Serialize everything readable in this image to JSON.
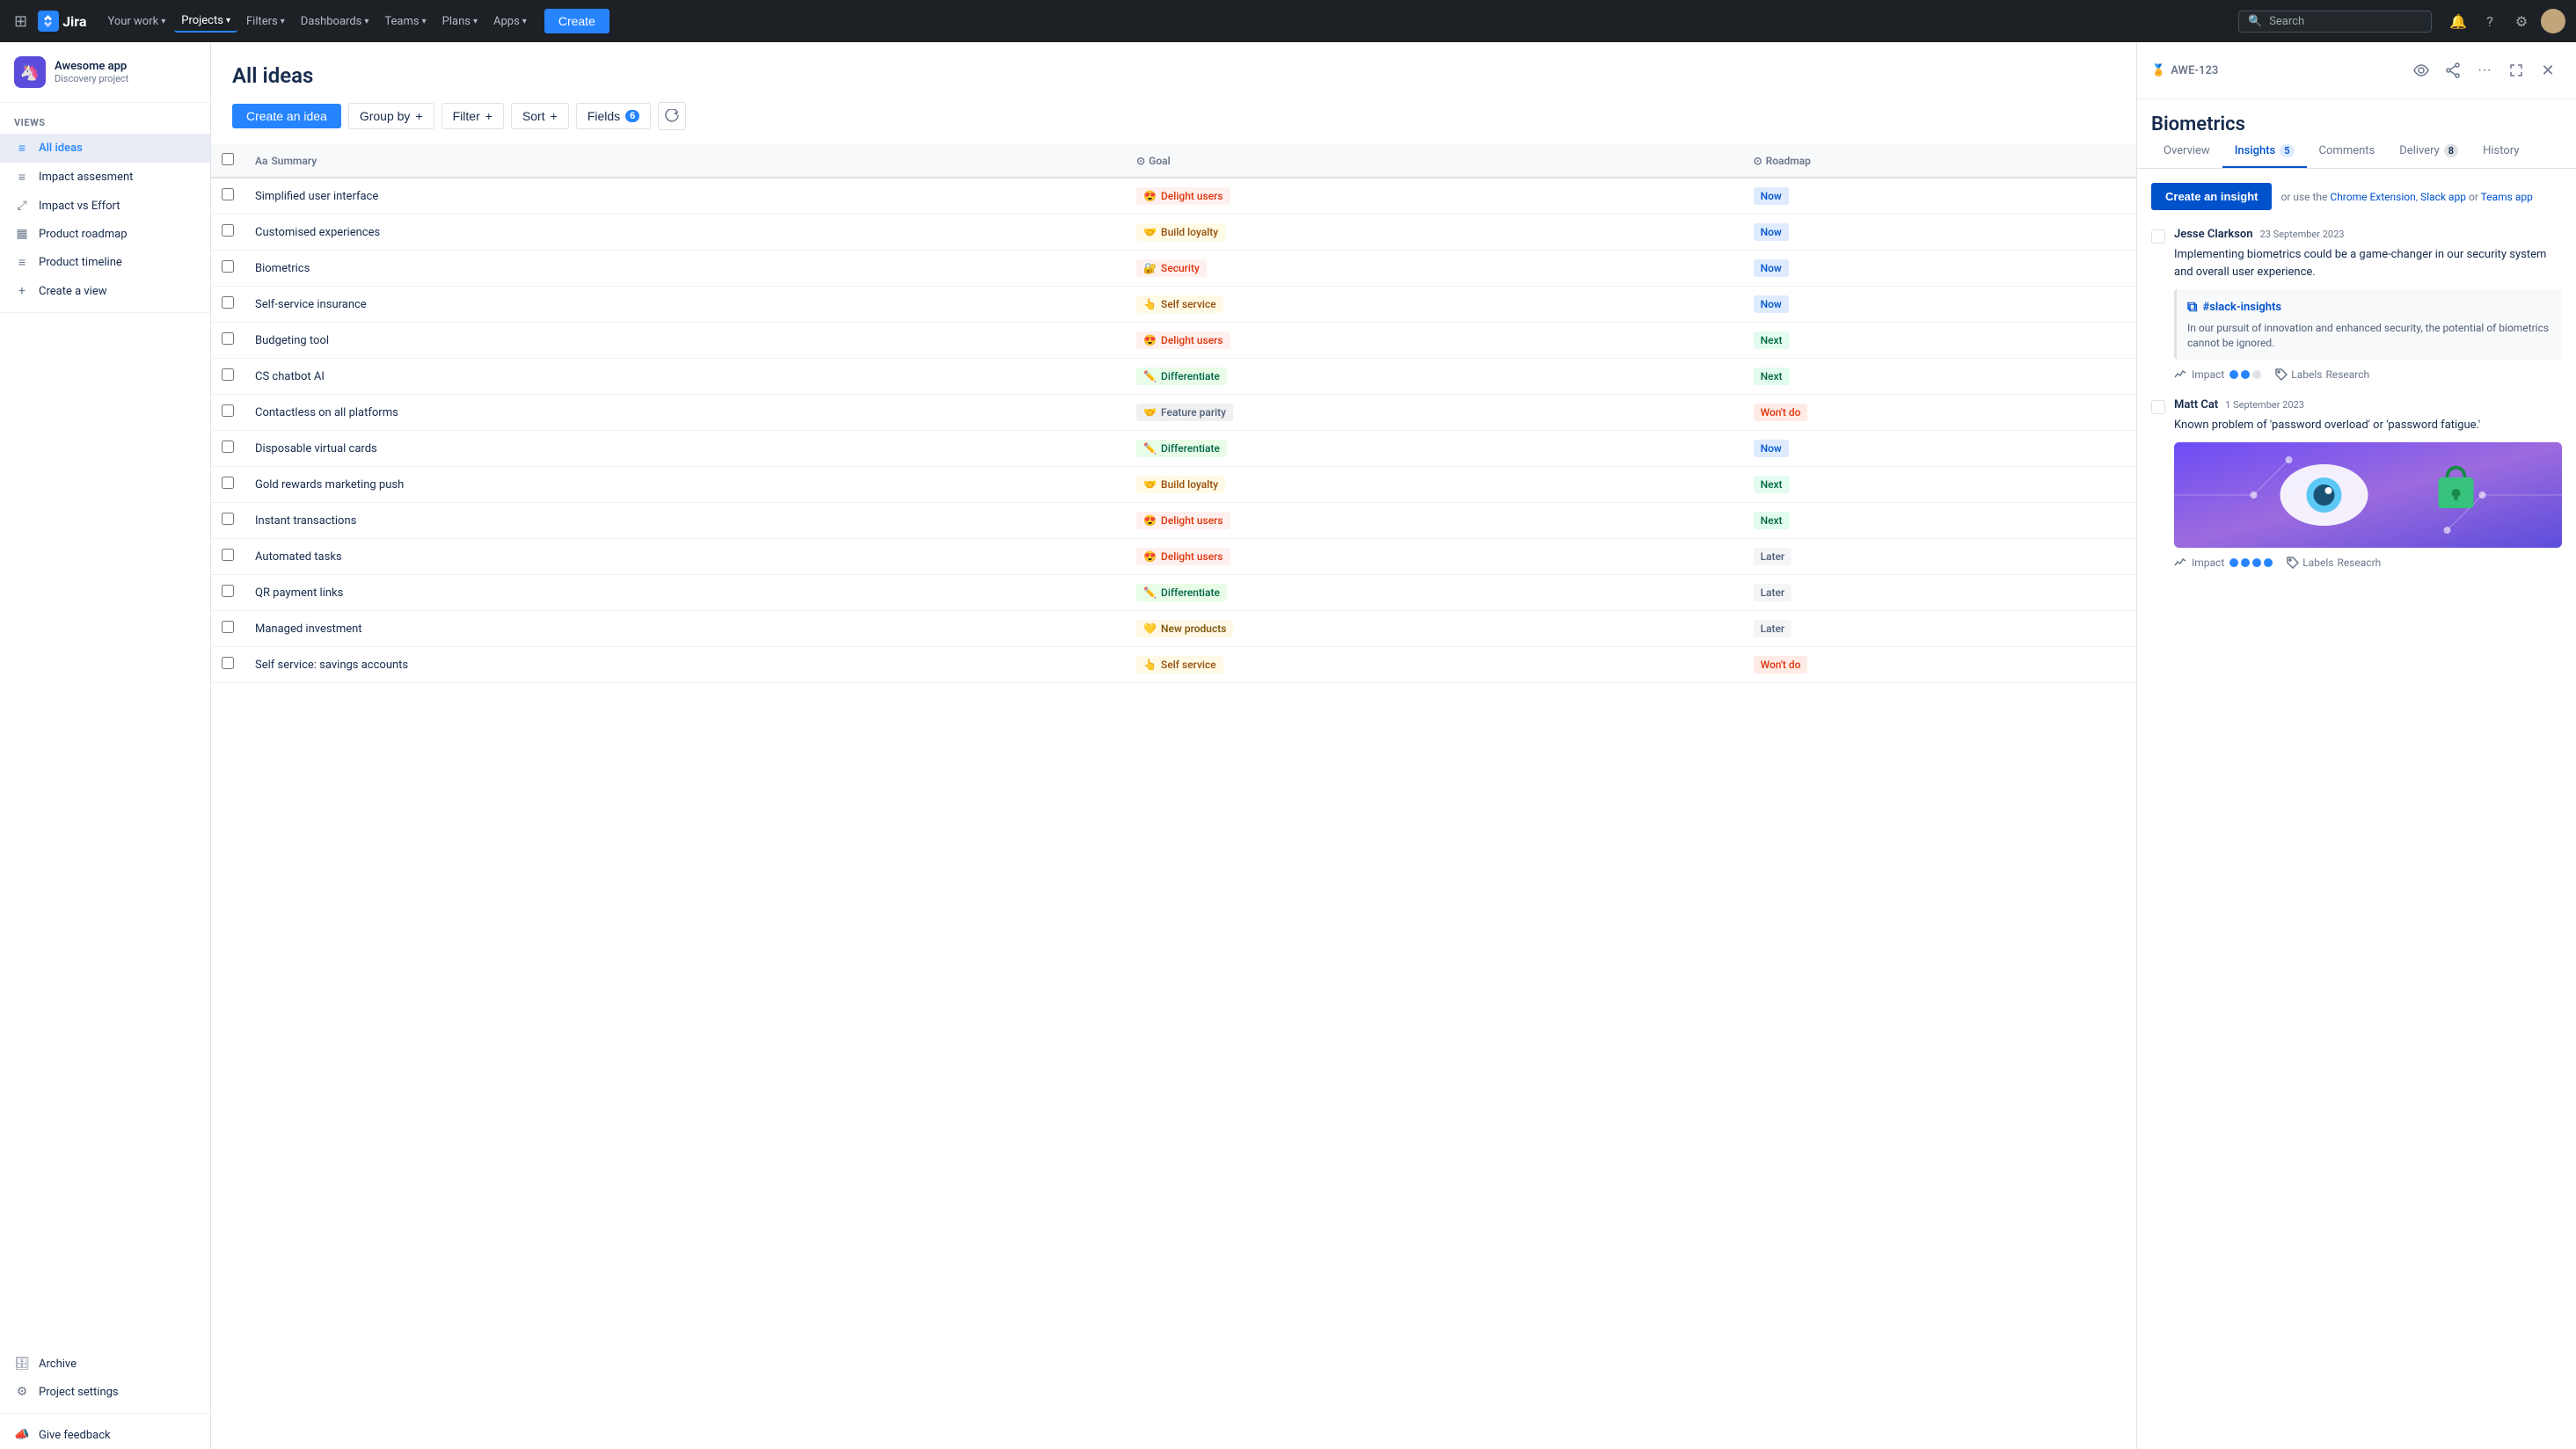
{
  "topnav": {
    "logo_text": "Jira",
    "nav_items": [
      {
        "label": "Your work",
        "has_dropdown": true,
        "active": false
      },
      {
        "label": "Projects",
        "has_dropdown": true,
        "active": true
      },
      {
        "label": "Filters",
        "has_dropdown": true,
        "active": false
      },
      {
        "label": "Dashboards",
        "has_dropdown": true,
        "active": false
      },
      {
        "label": "Teams",
        "has_dropdown": true,
        "active": false
      },
      {
        "label": "Plans",
        "has_dropdown": true,
        "active": false
      },
      {
        "label": "Apps",
        "has_dropdown": true,
        "active": false
      }
    ],
    "create_label": "Create",
    "search_placeholder": "Search"
  },
  "sidebar": {
    "project_name": "Awesome app",
    "project_type": "Discovery project",
    "views_label": "VIEWS",
    "views": [
      {
        "label": "All ideas",
        "icon": "≡",
        "active": true
      },
      {
        "label": "Impact assesment",
        "icon": "≡",
        "active": false
      },
      {
        "label": "Impact vs Effort",
        "icon": "⤢",
        "active": false
      },
      {
        "label": "Product roadmap",
        "icon": "▦",
        "active": false
      },
      {
        "label": "Product timeline",
        "icon": "≡",
        "active": false
      }
    ],
    "create_view_label": "Create a view",
    "archive_label": "Archive",
    "project_settings_label": "Project settings",
    "feedback_label": "Give feedback"
  },
  "main": {
    "title": "All ideas",
    "toolbar": {
      "create_label": "Create an idea",
      "group_by_label": "Group by",
      "filter_label": "Filter",
      "sort_label": "Sort",
      "fields_label": "Fields",
      "fields_count": "6"
    },
    "table_headers": [
      "",
      "Summary",
      "Goal",
      "Roadmap"
    ],
    "ideas": [
      {
        "summary": "Simplified user interface",
        "goal": "Delight users",
        "goal_class": "goal-delight",
        "goal_emoji": "😍",
        "roadmap": "Now",
        "roadmap_class": "roadmap-now"
      },
      {
        "summary": "Customised experiences",
        "goal": "Build loyalty",
        "goal_class": "goal-loyalty",
        "goal_emoji": "🤝",
        "roadmap": "Now",
        "roadmap_class": "roadmap-now"
      },
      {
        "summary": "Biometrics",
        "goal": "Security",
        "goal_class": "goal-security",
        "goal_emoji": "🔐",
        "roadmap": "Now",
        "roadmap_class": "roadmap-now"
      },
      {
        "summary": "Self-service insurance",
        "goal": "Self service",
        "goal_class": "goal-selfservice",
        "goal_emoji": "👆",
        "roadmap": "Now",
        "roadmap_class": "roadmap-now"
      },
      {
        "summary": "Budgeting tool",
        "goal": "Delight users",
        "goal_class": "goal-delight",
        "goal_emoji": "😍",
        "roadmap": "Next",
        "roadmap_class": "roadmap-next"
      },
      {
        "summary": "CS chatbot AI",
        "goal": "Differentiate",
        "goal_class": "goal-differentiate",
        "goal_emoji": "✏️",
        "roadmap": "Next",
        "roadmap_class": "roadmap-next"
      },
      {
        "summary": "Contactless on all platforms",
        "goal": "Feature parity",
        "goal_class": "goal-parity",
        "goal_emoji": "🤝",
        "roadmap": "Won't do",
        "roadmap_class": "roadmap-wontdo"
      },
      {
        "summary": "Disposable virtual cards",
        "goal": "Differentiate",
        "goal_class": "goal-differentiate",
        "goal_emoji": "✏️",
        "roadmap": "Now",
        "roadmap_class": "roadmap-now"
      },
      {
        "summary": "Gold rewards marketing push",
        "goal": "Build loyalty",
        "goal_class": "goal-loyalty",
        "goal_emoji": "🤝",
        "roadmap": "Next",
        "roadmap_class": "roadmap-next"
      },
      {
        "summary": "Instant transactions",
        "goal": "Delight users",
        "goal_class": "goal-delight",
        "goal_emoji": "😍",
        "roadmap": "Next",
        "roadmap_class": "roadmap-next"
      },
      {
        "summary": "Automated tasks",
        "goal": "Delight users",
        "goal_class": "goal-delight",
        "goal_emoji": "😍",
        "roadmap": "Later",
        "roadmap_class": "roadmap-later"
      },
      {
        "summary": "QR payment links",
        "goal": "Differentiate",
        "goal_class": "goal-differentiate",
        "goal_emoji": "✏️",
        "roadmap": "Later",
        "roadmap_class": "roadmap-later"
      },
      {
        "summary": "Managed investment",
        "goal": "New products",
        "goal_class": "goal-newproducts",
        "goal_emoji": "💛",
        "roadmap": "Later",
        "roadmap_class": "roadmap-later"
      },
      {
        "summary": "Self service: savings accounts",
        "goal": "Self service",
        "goal_class": "goal-selfservice",
        "goal_emoji": "👆",
        "roadmap": "Won't do",
        "roadmap_class": "roadmap-wontdo"
      }
    ]
  },
  "panel": {
    "id": "AWE-123",
    "title": "Biometrics",
    "tabs": [
      {
        "label": "Overview",
        "count": null,
        "active": false
      },
      {
        "label": "Insights",
        "count": "5",
        "active": true
      },
      {
        "label": "Comments",
        "count": null,
        "active": false
      },
      {
        "label": "Delivery",
        "count": "8",
        "active": false
      },
      {
        "label": "History",
        "count": null,
        "active": false
      }
    ],
    "create_insight_label": "Create an insight",
    "create_insight_help": "or use the",
    "chrome_extension_label": "Chrome Extension",
    "slack_app_label": "Slack app",
    "teams_app_label": "Teams app",
    "insights": [
      {
        "author": "Jesse Clarkson",
        "date": "23 September 2023",
        "text": "Implementing biometrics could be a game-changer in our security system and overall user experience.",
        "has_slack": true,
        "slack_channel": "#slack-insights",
        "slack_text": "In our pursuit of innovation and enhanced security, the potential of biometrics cannot be ignored.",
        "impact_dots": [
          true,
          true,
          false
        ],
        "labels_text": "Research",
        "has_image": false
      },
      {
        "author": "Matt Cat",
        "date": "1 September 2023",
        "text": "Known problem of 'password overload' or 'password fatigue.'",
        "has_slack": false,
        "slack_channel": "",
        "slack_text": "",
        "impact_dots": [
          true,
          true,
          true,
          true
        ],
        "labels_text": "Reseacrh",
        "has_image": true
      }
    ]
  }
}
